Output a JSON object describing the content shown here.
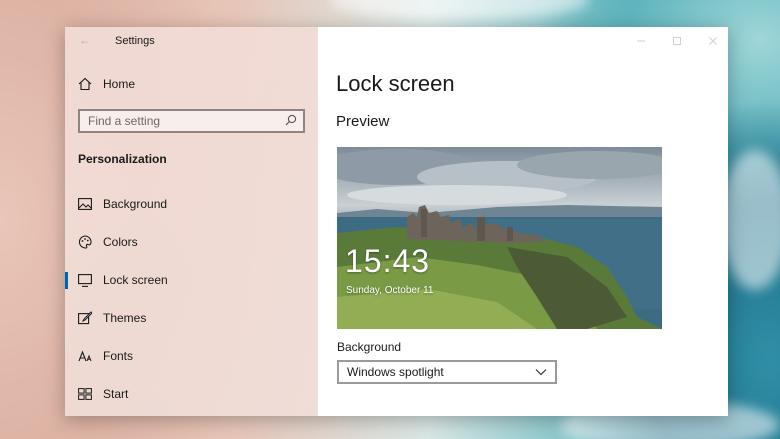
{
  "window": {
    "title": "Settings"
  },
  "sidebar": {
    "home_label": "Home",
    "search": {
      "placeholder": "Find a setting"
    },
    "section_title": "Personalization",
    "items": [
      {
        "label": "Background",
        "icon": "image-icon"
      },
      {
        "label": "Colors",
        "icon": "palette-icon"
      },
      {
        "label": "Lock screen",
        "icon": "monitor-icon",
        "active": true
      },
      {
        "label": "Themes",
        "icon": "brush-icon"
      },
      {
        "label": "Fonts",
        "icon": "font-icon"
      },
      {
        "label": "Start",
        "icon": "start-icon"
      }
    ]
  },
  "main": {
    "page_title": "Lock screen",
    "preview_heading": "Preview",
    "preview": {
      "time": "15:43",
      "date": "Sunday, October 11"
    },
    "background_label": "Background",
    "background_value": "Windows spotlight"
  },
  "colors": {
    "accent": "#0063b1"
  }
}
